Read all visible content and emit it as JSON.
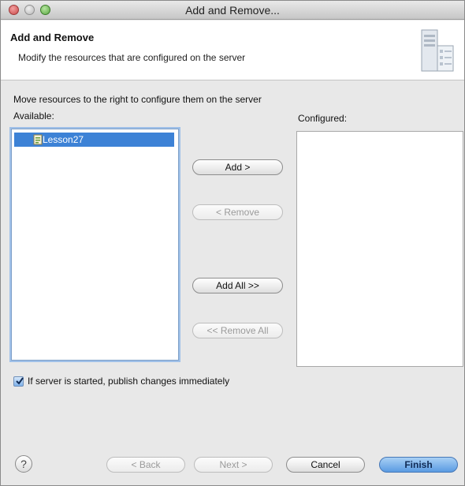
{
  "window": {
    "title": "Add and Remove..."
  },
  "banner": {
    "title": "Add and Remove",
    "description": "Modify the resources that are configured on the server"
  },
  "instructions": "Move resources to the right to configure them on the server",
  "available": {
    "label": "Available:",
    "items": [
      {
        "label": "Lesson27",
        "selected": true
      }
    ]
  },
  "configured": {
    "label": "Configured:",
    "items": []
  },
  "buttons": {
    "add": "Add >",
    "remove": "< Remove",
    "add_all": "Add All >>",
    "remove_all": "<< Remove All"
  },
  "options": {
    "publish_label": "If server is started, publish changes immediately",
    "publish_checked": true
  },
  "footer": {
    "help": "?",
    "back": "< Back",
    "next": "Next >",
    "cancel": "Cancel",
    "finish": "Finish"
  },
  "colors": {
    "selection": "#3d82d6",
    "primary_button": "#5a9be2"
  }
}
